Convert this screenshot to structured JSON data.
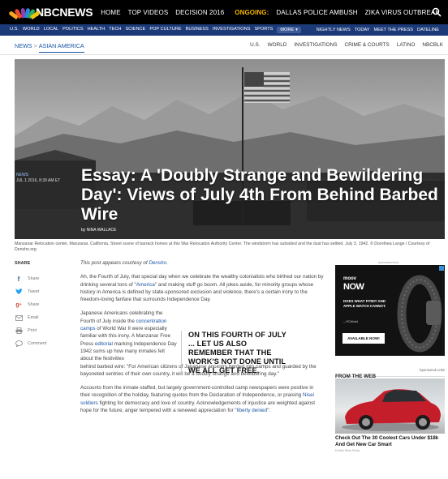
{
  "colors": {
    "topbar": "#000000",
    "subbar": "#1c3a78",
    "accent": "#1a56a6",
    "ongoing": "#f5b400"
  },
  "header": {
    "logo_text": "NBCNEWS",
    "nav": [
      "HOME",
      "TOP VIDEOS",
      "DECISION 2016"
    ],
    "ongoing_label": "ONGOING:",
    "ongoing_items": [
      "DALLAS POLICE AMBUSH",
      "ZIKA VIRUS OUTBREAK"
    ]
  },
  "subnav": {
    "left": [
      "U.S.",
      "WORLD",
      "LOCAL",
      "POLITICS",
      "HEALTH",
      "TECH",
      "SCIENCE",
      "POP CULTURE",
      "BUSINESS",
      "INVESTIGATIONS",
      "SPORTS"
    ],
    "more_label": "MORE",
    "right": [
      "NIGHTLY NEWS",
      "TODAY",
      "MEET THE PRESS",
      "DATELINE"
    ]
  },
  "breadcrumb": {
    "section": "NEWS",
    "subsection": "ASIAN AMERICA"
  },
  "section_nav": [
    "U.S.",
    "WORLD",
    "INVESTIGATIONS",
    "CRIME & COURTS",
    "LATINO",
    "NBCBLK"
  ],
  "hero": {
    "tag": "NEWS",
    "date": "JUL 1 2016, 8:39 AM ET",
    "title": "Essay: A 'Doubly Strange and Bewildering Day': Views of July 4th From Behind Barbed Wire",
    "byline": "by NINA WALLACE"
  },
  "caption": "Manzanar Relocation center, Manzanar, California. Street scene of barrack homes at this War Relocation Authority Center. The windstorm has subsided and the dust has settled. July 3, 1942. © Dorothea Lange / Courtesy of Densho.org",
  "share": {
    "title": "SHARE",
    "items": [
      {
        "label": "Share",
        "icon": "facebook-icon",
        "color": "#3b5998"
      },
      {
        "label": "Tweet",
        "icon": "twitter-icon",
        "color": "#1da1f2"
      },
      {
        "label": "Share",
        "icon": "googleplus-icon",
        "color": "#dd4b39"
      },
      {
        "label": "Email",
        "icon": "email-icon",
        "color": "#888888"
      },
      {
        "label": "Print",
        "icon": "print-icon",
        "color": "#888888"
      },
      {
        "label": "Comment",
        "icon": "comment-icon",
        "color": "#888888"
      }
    ]
  },
  "article": {
    "intro_pre": "This post appears courtesy of ",
    "intro_link": "Densho",
    "intro_post": ".",
    "p1_a": "Ah, the Fourth of July, that special day when we celebrate the wealthy colonialists who birthed our nation by drinking several tons of \"",
    "p1_link": "America",
    "p1_b": "\" and making stuff go boom. All jokes aside, for minority groups whose history in America is defined by state-sponsored exclusion and violence, there's a certain irony to the freedom-loving fanfare that surrounds Independence Day.",
    "p2_a": "Japanese Americans celebrating the Fourth of July inside the ",
    "p2_link1": "concentration camps",
    "p2_b": " of World War II were especially familiar with this irony. A Manzanar Free Press ",
    "p2_link2": "editorial",
    "p2_c": " marking Independence Day 1942 sums up how many inmates felt about the festivities",
    "p2_d": "behind barbed wire: \"For American citizens of Japanese ancestry herded into camps and guarded by the bayoneted sentries of their own country, it will be a doubly strange and bewildering day.\"",
    "pullquote": "ON THIS FOURTH OF JULY ... LET US ALSO REMEMBER THAT THE WORK'S NOT DONE UNTIL WE ALL GET FREE.",
    "p3_a": "Accounts from the inmate-staffed, but largely government-controlled camp newspapers were positive in their recognition of the holiday, featuring quotes from the Declaration of Independence, or praising ",
    "p3_link": "Nisei soldiers",
    "p3_b": " fighting for democracy and love of country. Acknowledgements of injustice are weighted against hope for the future, anger tempered with a renewed appreciation for \"",
    "p3_link2": "liberty denied",
    "p3_c": "\":"
  },
  "ad": {
    "label": "advertisement",
    "brand_small": "moov",
    "brand": "NOW",
    "text": "DOES WHAT FITBIT AND APPLE WATCH CANNOT.",
    "source": "—PCWorld",
    "cta": "AVAILABLE NOW!"
  },
  "from_the_web": {
    "title": "FROM THE WEB",
    "sponsor": "Sponsored Links",
    "item_title": "Check Out The 30 Coolest Cars Under $18k And Get New Car Smart",
    "item_source": "Kelley Blue Book"
  }
}
